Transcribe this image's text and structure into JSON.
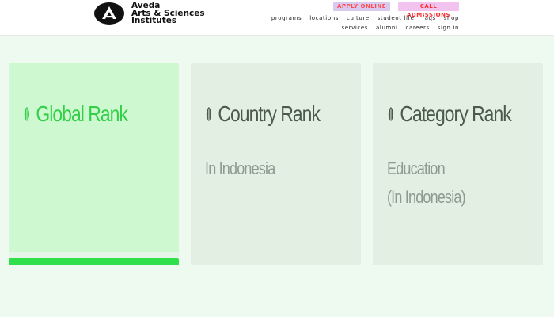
{
  "header": {
    "logo_mark": "aveda-triangle-logo",
    "brand_line1": "Aveda",
    "brand_line2": "Arts & Sciences",
    "brand_line3": "Institutes",
    "apply_label": "APPLY ONLINE",
    "call_label": "CALL ADMISSIONS",
    "nav_row1": [
      "programs",
      "locations",
      "culture",
      "student life",
      "faqs",
      "shop"
    ],
    "nav_row2": [
      "services",
      "alumni",
      "careers",
      "sign in"
    ]
  },
  "cards": [
    {
      "title": "Global Rank",
      "icon": "leaf-icon",
      "sub1": "",
      "sub2": ""
    },
    {
      "title": "Country Rank",
      "icon": "leaf-icon",
      "sub1": "In Indonesia",
      "sub2": ""
    },
    {
      "title": "Category Rank",
      "icon": "leaf-icon",
      "sub1": "Education",
      "sub2": "(In Indonesia)"
    }
  ],
  "global_rank_progress": 1.0,
  "colors": {
    "accent_green": "#2fe04b",
    "active_card": "#cdf8d0",
    "inactive_card": "#e4efe4",
    "page_bg": "#eefaef",
    "apply_bg": "#d9c9ef",
    "call_bg": "#f3c3ef",
    "button_text": "#ff3b3b"
  }
}
